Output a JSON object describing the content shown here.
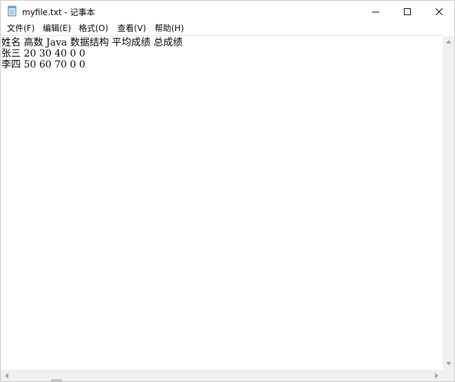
{
  "window": {
    "title": "myfile.txt - 记事本"
  },
  "menu": {
    "items": [
      {
        "label": "文件(F)"
      },
      {
        "label": "编辑(E)"
      },
      {
        "label": "格式(O)"
      },
      {
        "label": "查看(V)"
      },
      {
        "label": "帮助(H)"
      }
    ]
  },
  "editor": {
    "lines": [
      "姓名 高数 Java 数据结构 平均成绩 总成绩",
      "张三 20 30 40 0 0",
      "李四 50 60 70 0 0"
    ]
  },
  "icons": {
    "app": "notepad-icon",
    "minimize": "minimize-icon",
    "maximize": "maximize-icon",
    "close": "close-icon"
  },
  "colors": {
    "background": "#ffffff",
    "scrollbar": "#f0f0f0",
    "text": "#000000"
  }
}
